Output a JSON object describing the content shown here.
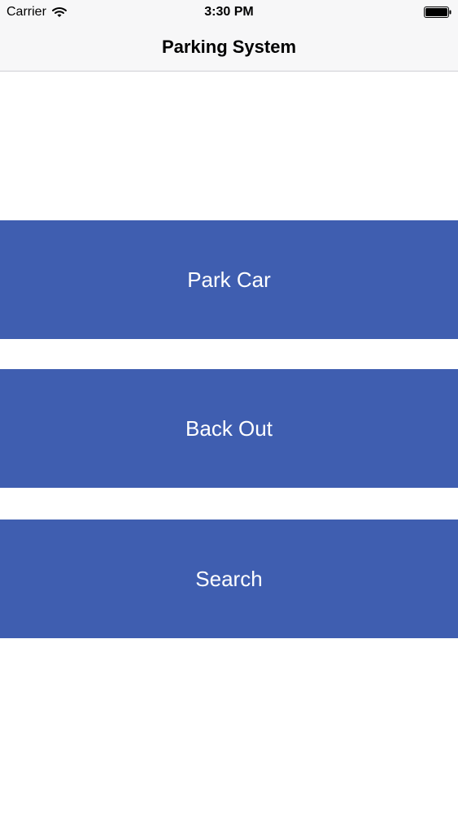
{
  "status_bar": {
    "carrier": "Carrier",
    "time": "3:30 PM",
    "wifi_icon": "wifi-icon",
    "battery_icon": "battery-icon"
  },
  "nav": {
    "title": "Parking System"
  },
  "buttons": {
    "park_car": "Park Car",
    "back_out": "Back Out",
    "search": "Search"
  },
  "colors": {
    "button_background": "#3f5eb0",
    "button_text": "#ffffff",
    "bar_background": "#f7f7f8"
  }
}
